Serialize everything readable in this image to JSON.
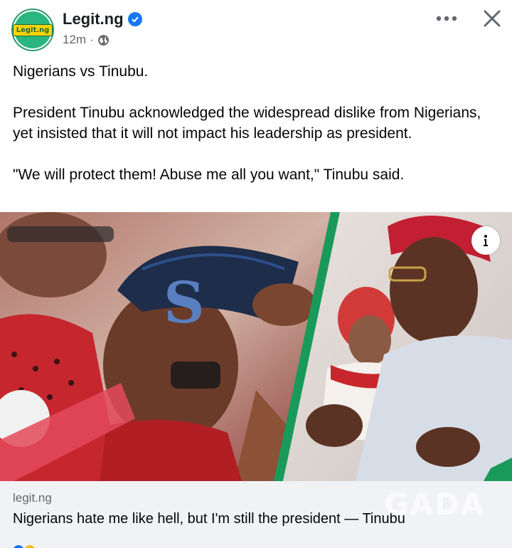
{
  "header": {
    "page_name": "Legit.ng",
    "avatar_text": "Legit.ng",
    "time": "12m",
    "separator": "·"
  },
  "post": {
    "paragraphs": [
      "Nigerians vs Tinubu.",
      "President Tinubu acknowledged the widespread dislike from Nigerians, yet insisted that it will not impact his leadership as president.",
      "\"We will protect them! Abuse me all you want,\" Tinubu said."
    ]
  },
  "link_card": {
    "domain": "legit.ng",
    "title": "Nigerians hate me like hell, but I'm still the president — Tinubu",
    "watermark": "GADA"
  },
  "colors": {
    "verified": "#1877f2",
    "link_card_bg": "#f0f2f5",
    "brand_green": "#2bb57f"
  },
  "icons": [
    "verified-badge-icon",
    "globe-icon",
    "more-options-icon",
    "close-icon",
    "info-icon"
  ]
}
